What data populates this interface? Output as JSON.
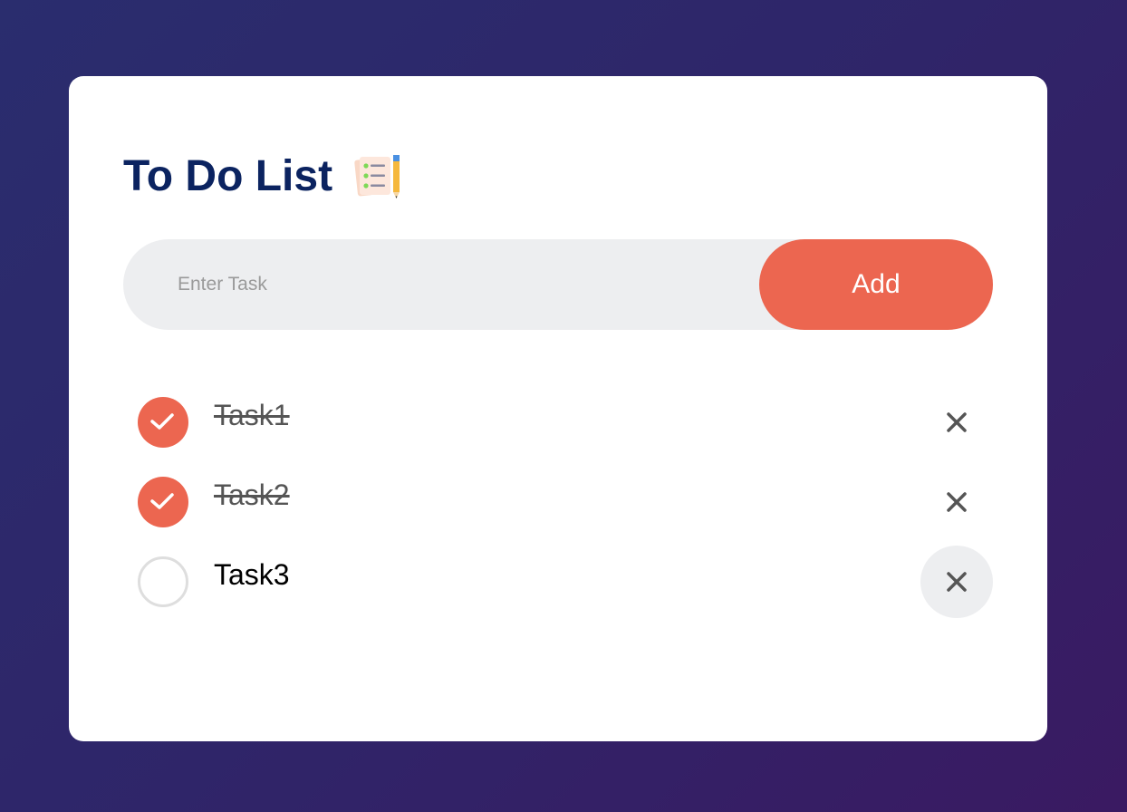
{
  "app": {
    "title": "To Do List",
    "title_icon": "notepad-pencil-icon"
  },
  "input": {
    "placeholder": "Enter Task",
    "value": ""
  },
  "add_button": {
    "label": "Add"
  },
  "tasks": [
    {
      "label": "Task1",
      "checked": true,
      "delete_icon": "close-icon"
    },
    {
      "label": "Task2",
      "checked": true,
      "delete_icon": "close-icon"
    },
    {
      "label": "Task3",
      "checked": false,
      "delete_icon": "close-icon"
    }
  ],
  "colors": {
    "accent": "#ec6650",
    "title": "#0b2360",
    "input_bg": "#edeef0",
    "background_start": "#2a2d6e",
    "background_end": "#3a1a62"
  }
}
